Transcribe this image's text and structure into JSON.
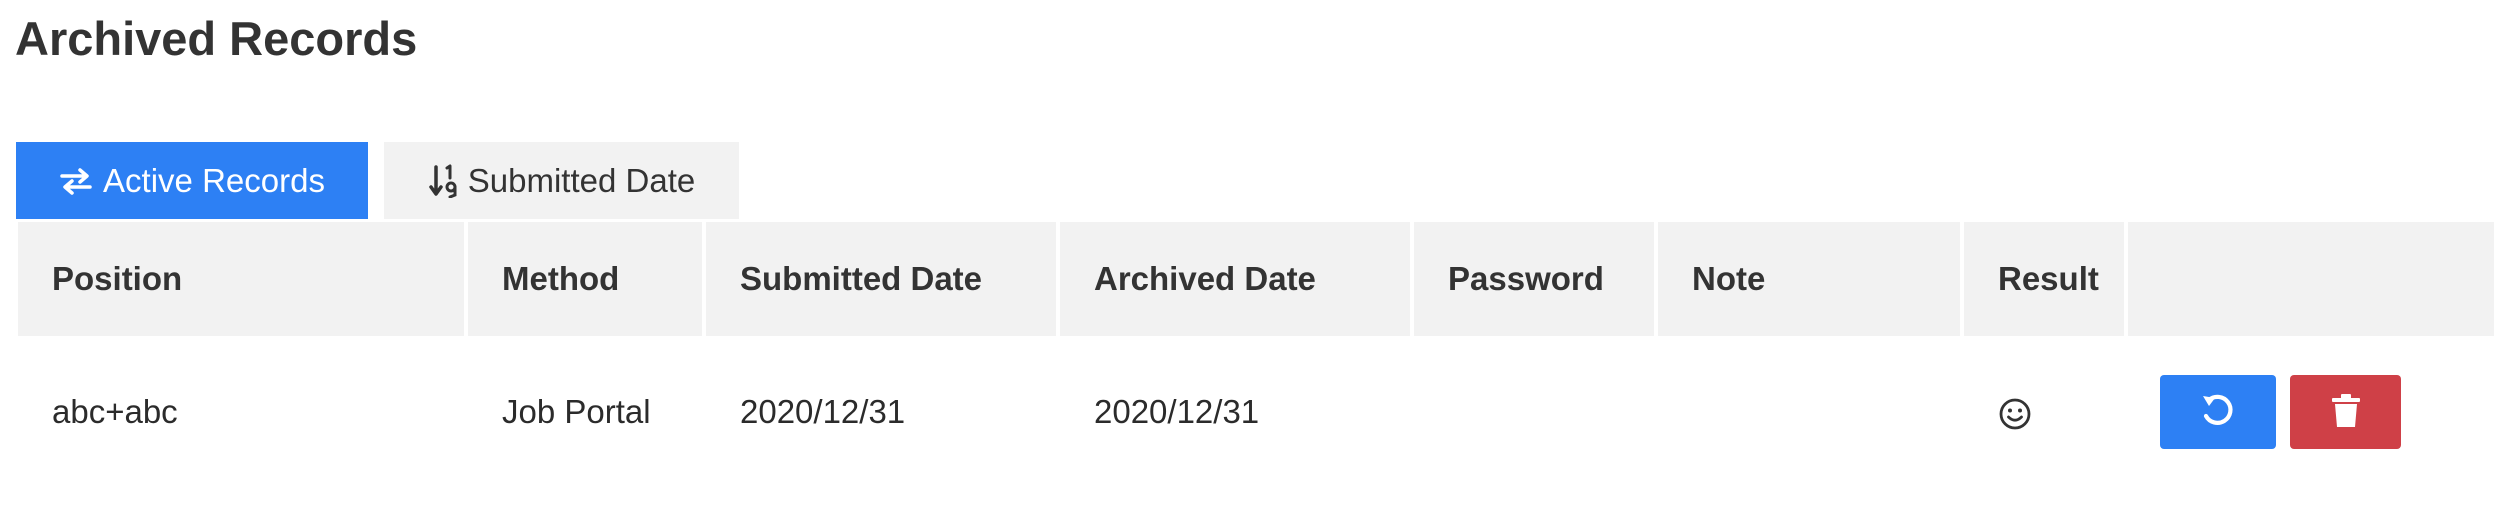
{
  "page": {
    "title": "Archived Records"
  },
  "toolbar": {
    "active_records_label": "Active Records",
    "active_records_icon": "exchange-icon",
    "sort_label": "Submitted Date",
    "sort_icon": "sort-numeric-down-icon"
  },
  "table": {
    "columns": [
      "Position",
      "Method",
      "Submitted Date",
      "Archived Date",
      "Password",
      "Note",
      "Result",
      ""
    ],
    "rows": [
      {
        "position": "abc+abc",
        "method": "Job Portal",
        "submitted_date": "2020/12/31",
        "archived_date": "2020/12/31",
        "password": "",
        "note": "",
        "result_icon": "smile-icon",
        "actions": [
          "restore-icon",
          "trash-icon"
        ]
      }
    ]
  },
  "colors": {
    "primary": "#2d80f4",
    "danger": "#cf4047",
    "header_bg": "#f2f2f2",
    "title": "#333333"
  }
}
